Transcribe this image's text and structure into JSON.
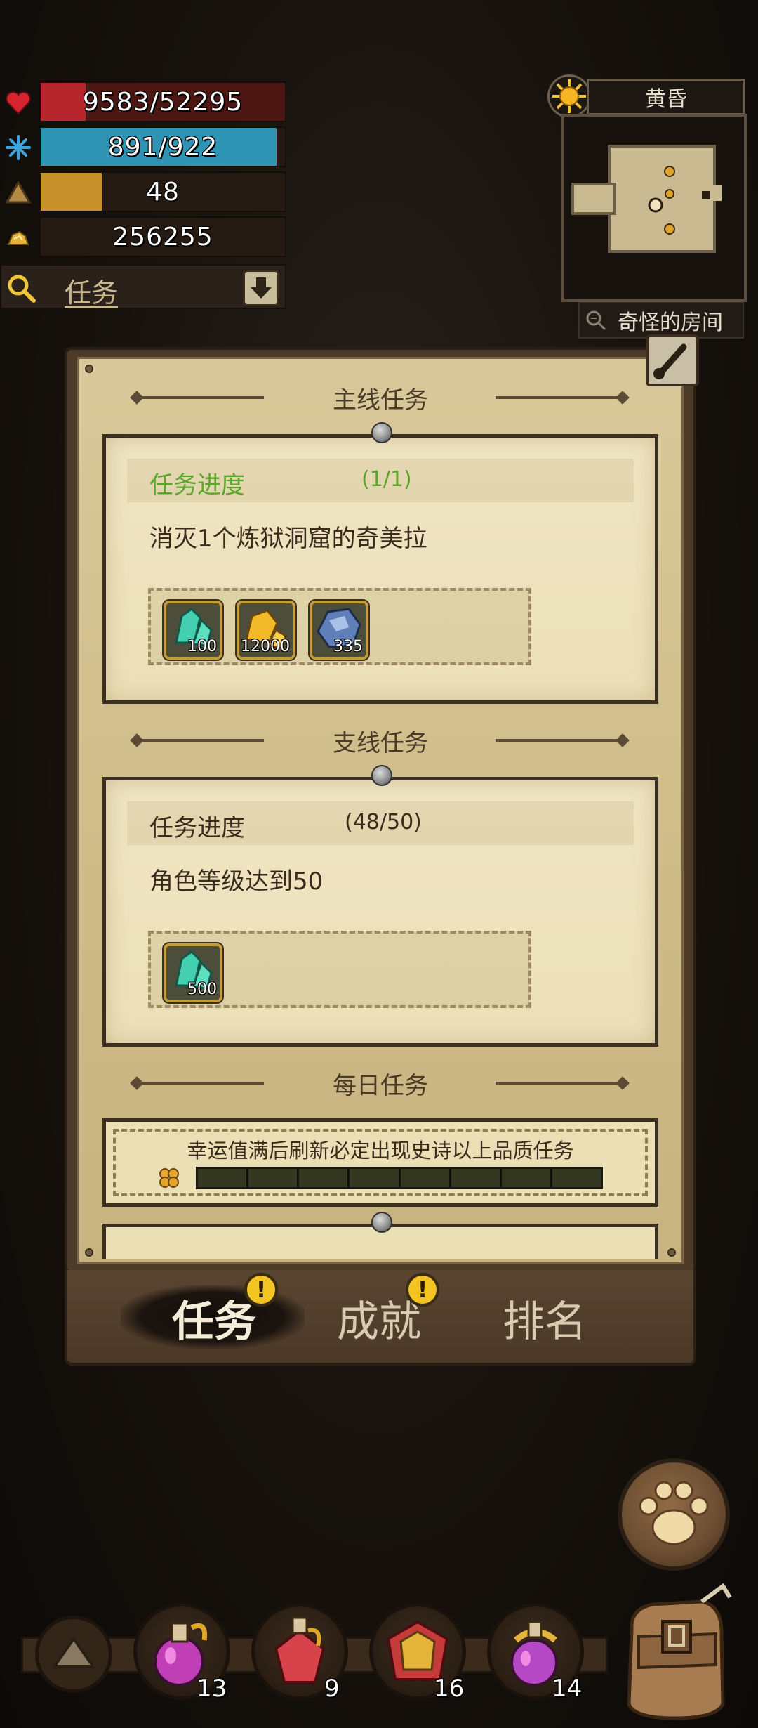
{
  "stats": {
    "hp": {
      "value": "9583/52295",
      "ratio": 0.183,
      "color": "#b8262d"
    },
    "mp": {
      "value": "891/922",
      "ratio": 0.966,
      "color": "#2f93b4"
    },
    "level": {
      "value": "48",
      "ratio": 0.25,
      "color": "#c7902b"
    },
    "gold": {
      "value": "256255"
    }
  },
  "quest_dropdown": {
    "label": "任务"
  },
  "minimap": {
    "time_of_day": "黄昏",
    "location": "奇怪的房间"
  },
  "main_quest": {
    "title": "主线任务",
    "progress_label": "任务进度",
    "progress_value": "(1/1)",
    "description": "消灭1个炼狱洞窟的奇美拉",
    "rewards": [
      {
        "icon": "green-crystal-icon",
        "qty": "100"
      },
      {
        "icon": "gold-ore-icon",
        "qty": "12000"
      },
      {
        "icon": "blue-ore-icon",
        "qty": "335"
      }
    ]
  },
  "side_quest": {
    "title": "支线任务",
    "progress_label": "任务进度",
    "progress_value": "(48/50)",
    "description": "角色等级达到50",
    "rewards": [
      {
        "icon": "green-crystal-icon",
        "qty": "500"
      }
    ]
  },
  "daily_quest": {
    "title": "每日任务",
    "luck_text": "幸运值满后刷新必定出现史诗以上品质任务",
    "luck_segments": 8,
    "luck_filled": 0
  },
  "tabs": [
    {
      "label": "任务",
      "active": true,
      "alert": "!"
    },
    {
      "label": "成就",
      "active": false,
      "alert": "!"
    },
    {
      "label": "排名",
      "active": false
    }
  ],
  "hotbar": [
    {
      "icon": "purple-potion-icon",
      "count": "13"
    },
    {
      "icon": "red-potion-icon",
      "count": "9"
    },
    {
      "icon": "red-gold-armor-icon",
      "count": "16"
    },
    {
      "icon": "purple-gold-potion-icon",
      "count": "14"
    }
  ],
  "colors": {
    "accent_green": "#5aa629",
    "parchment": "#ebe0b8",
    "panel_brown": "#4e3c2a"
  }
}
